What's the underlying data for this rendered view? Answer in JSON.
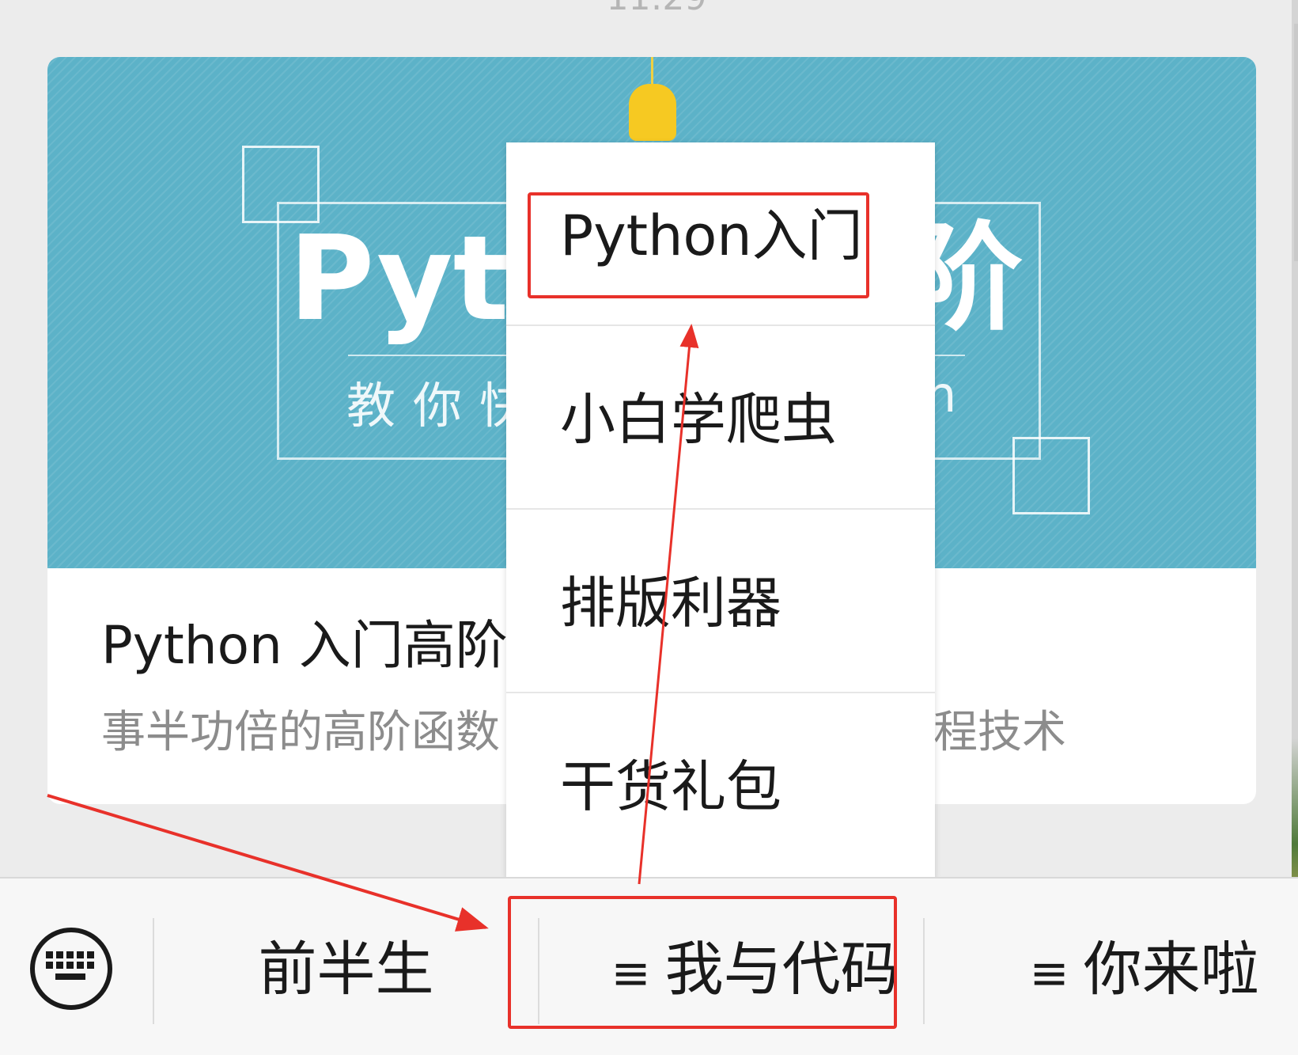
{
  "status": {
    "time": "11:29"
  },
  "article": {
    "cover": {
      "title_left": "Pyt",
      "title_right": "阶",
      "subtitle_left": "教你快",
      "subtitle_right": "n"
    },
    "title": "Python 入门高阶",
    "description_left": "事半功倍的高阶函数",
    "description_right": "程技术"
  },
  "submenu": {
    "items": [
      {
        "label": "Python入门"
      },
      {
        "label": "小白学爬虫"
      },
      {
        "label": "排版利器"
      },
      {
        "label": "干货礼包"
      }
    ]
  },
  "menubar": {
    "keyboard_icon": "keyboard-icon",
    "items": [
      {
        "label": "前半生",
        "has_submenu": false
      },
      {
        "label": "我与代码",
        "has_submenu": true
      },
      {
        "label": "你来啦",
        "has_submenu": true
      }
    ],
    "submenu_glyph": "≡"
  },
  "annotations": {
    "color": "#e8312a"
  }
}
